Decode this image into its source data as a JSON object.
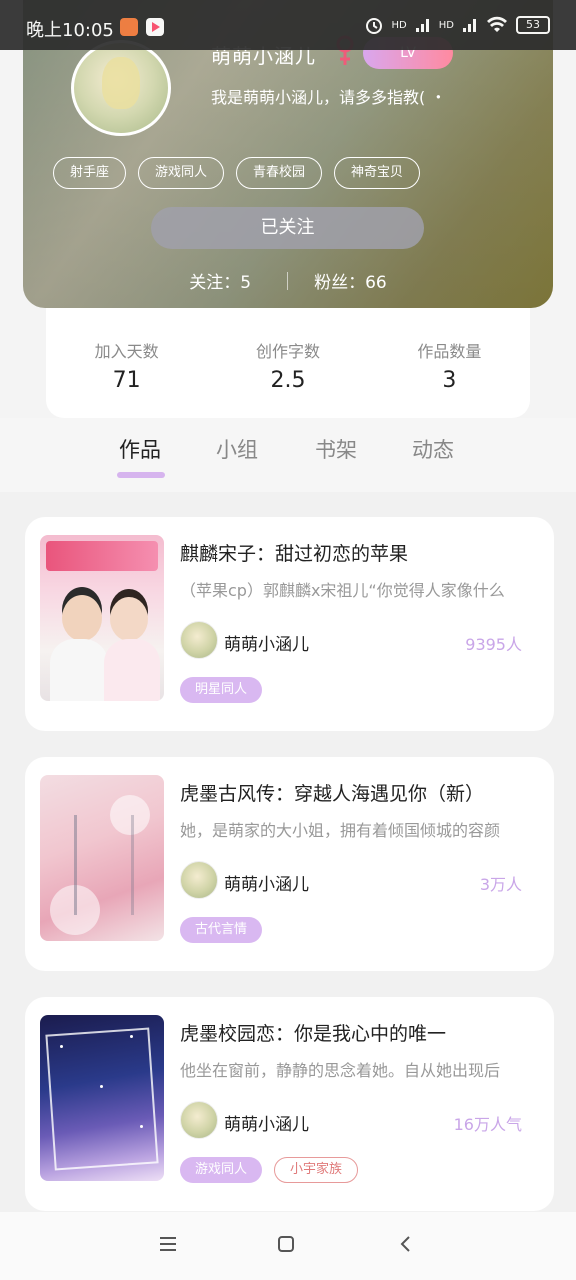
{
  "status_bar": {
    "time": "晚上10:05",
    "battery": "53",
    "network_labels": [
      "HD",
      "HD"
    ]
  },
  "profile": {
    "name": "萌萌小涵儿",
    "level_label": "LV",
    "bio": "我是萌萌小涵儿，请多多指教( ・",
    "tags": [
      "射手座",
      "游戏同人",
      "青春校园",
      "神奇宝贝"
    ],
    "follow_button": "已关注",
    "following": "关注：5",
    "followers": "粉丝：66"
  },
  "stats": [
    {
      "label": "加入天数",
      "value": "71"
    },
    {
      "label": "创作字数",
      "value": "2.5"
    },
    {
      "label": "作品数量",
      "value": "3"
    }
  ],
  "tabs": [
    "作品",
    "小组",
    "书架",
    "动态"
  ],
  "works": [
    {
      "title": "麒麟宋子：甜过初恋的苹果",
      "desc": "（苹果cp）郭麒麟x宋祖儿“你觉得人家像什么",
      "author": "萌萌小涵儿",
      "count": "9395人",
      "genres": [
        "明星同人"
      ]
    },
    {
      "title": "虎墨古风传：穿越人海遇见你（新）",
      "desc": "她，是萌家的大小姐，拥有着倾国倾城的容颜",
      "author": "萌萌小涵儿",
      "count": "3万人",
      "genres": [
        "古代言情"
      ]
    },
    {
      "title": "虎墨校园恋：你是我心中的唯一",
      "desc": "他坐在窗前，静静的思念着她。自从她出现后",
      "author": "萌萌小涵儿",
      "count": "16万人气",
      "genres": [
        "游戏同人",
        "小宇家族"
      ]
    }
  ],
  "colors": {
    "accent": "#d9b8f1",
    "count_text": "#c9a6e8",
    "outline_tag": "#e07a7a"
  }
}
